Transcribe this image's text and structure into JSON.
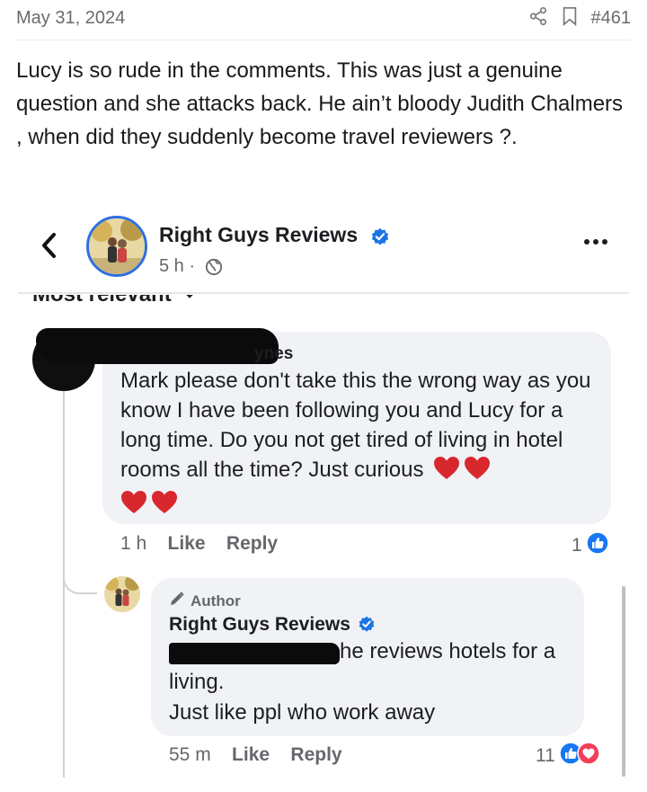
{
  "post": {
    "date": "May 31, 2024",
    "number": "#461",
    "body": "Lucy is so rude in the comments. This was just a genuine question and she attacks back. He ain’t bloody Judith Chalmers , when did they suddenly become travel reviewers ?.",
    "icons": [
      "share-icon",
      "bookmark-icon"
    ]
  },
  "fb": {
    "page_name": "Right Guys Reviews",
    "post_time": "5 h ·",
    "sort_label": "Most relevant",
    "comment": {
      "name_fragment": "ynes",
      "text": "Mark please don't take this the wrong way as you know I have been following you and Lucy for a long time. Do you not get tired of  living in hotel rooms all the time? Just curious ",
      "time": "1 h",
      "like": "Like",
      "reply": "Reply",
      "reaction_count": "1"
    },
    "reply": {
      "badge": "Author",
      "name": "Right Guys Reviews",
      "text": "he reviews hotels for a living.",
      "text2": "Just like ppl who work away",
      "time": "55 m",
      "like": "Like",
      "reply": "Reply",
      "reaction_count": "11"
    },
    "colors": {
      "verified": "#1b74e4",
      "like": "#1877f2",
      "love": "#f33e58",
      "heart": "#d9272e"
    }
  }
}
